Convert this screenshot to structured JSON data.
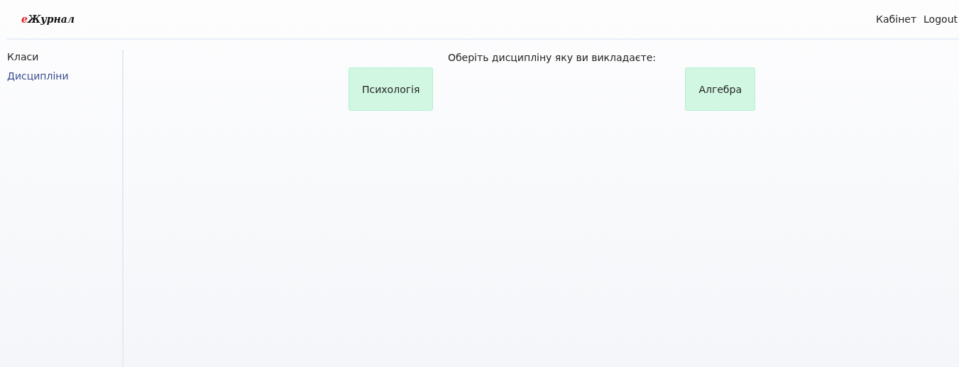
{
  "logo": {
    "accent": "е",
    "rest": "Журнал"
  },
  "nav": [
    "Кабінет",
    "Logout"
  ],
  "sidebar": {
    "items": [
      {
        "label": "Класи",
        "selected": false
      },
      {
        "label": "Дисципліни",
        "selected": true
      }
    ]
  },
  "prompt": "Оберіть дисципліну яку ви викладаєте:",
  "disciplines": [
    "Психологія",
    "Алгебра"
  ]
}
